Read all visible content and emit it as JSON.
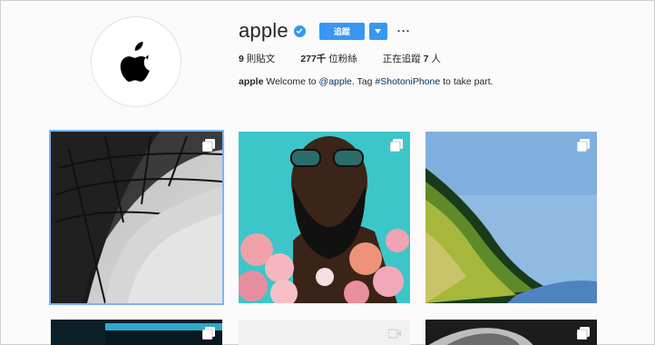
{
  "profile": {
    "username": "apple",
    "follow_label": "追蹤",
    "more_label": "···",
    "stats": {
      "posts_count": "9",
      "posts_label": "則貼文",
      "followers_count": "277千",
      "followers_label": "位粉絲",
      "following_prefix": "正在追蹤",
      "following_count": "7",
      "following_suffix": "人"
    },
    "bio": {
      "name": "apple",
      "text_1": "Welcome to",
      "mention": "@apple",
      "text_2": ". Tag",
      "hashtag": "#ShotoniPhone",
      "text_3": "to take part."
    }
  },
  "colors": {
    "accent": "#3897f0",
    "link": "#003569",
    "background": "#fafafa"
  },
  "icons": [
    "apple-logo-icon",
    "verified-badge-icon",
    "chevron-down-icon",
    "multiple-posts-icon"
  ]
}
